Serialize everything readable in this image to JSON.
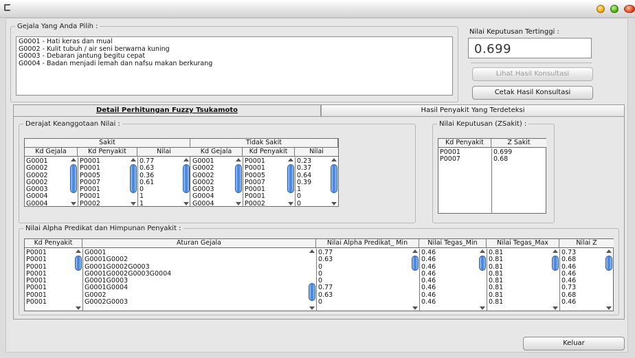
{
  "gejala_group": {
    "legend": "Gejala Yang Anda Pilih :",
    "items": [
      "G0001 - Hati keras dan mual",
      "G0002 - Kulit tubuh / air seni berwarna kuning",
      "G0003 - Debaran jantung begitu cepat",
      "G0004 - Badan menjadi lemah dan nafsu makan berkurang"
    ]
  },
  "keputusan": {
    "label": "Nilai Keputusan Tertinggi :",
    "value": "0.699"
  },
  "buttons": {
    "lihat": "Lihat Hasil Konsultasi",
    "cetak": "Cetak Hasil Konsultasi",
    "keluar": "Keluar"
  },
  "tabs": [
    {
      "label": "Detail Perhitungan Fuzzy Tsukamoto",
      "active": true
    },
    {
      "label": "Hasil Penyakit Yang Terdeteksi",
      "active": false
    }
  ],
  "derajat": {
    "legend": "Derajat Keanggotaan Nilai :",
    "sakit_title": "Sakit",
    "tidak_sakit_title": "Tidak Sakit",
    "headers": [
      "Kd Gejala",
      "Kd Penyakit",
      "Nilai"
    ],
    "sakit": {
      "kd_gejala": [
        "G0001",
        "G0002",
        "G0002",
        "G0002",
        "G0003",
        "G0004",
        "G0004"
      ],
      "kd_penyakit": [
        "P0001",
        "P0001",
        "P0005",
        "P0007",
        "P0001",
        "P0001",
        "P0002"
      ],
      "nilai": [
        "0.77",
        "0.63",
        "0.36",
        "0.61",
        "0",
        "1",
        "1"
      ]
    },
    "tidak_sakit": {
      "kd_gejala": [
        "G0001",
        "G0002",
        "G0002",
        "G0002",
        "G0003",
        "G0004",
        "G0004"
      ],
      "kd_penyakit": [
        "P0001",
        "P0001",
        "P0005",
        "P0007",
        "P0001",
        "P0001",
        "P0002"
      ],
      "nilai": [
        "0.23",
        "0.37",
        "0.64",
        "0.39",
        "1",
        "0",
        "0"
      ]
    }
  },
  "zsakit": {
    "legend": "Nilai Keputusan (ZSakit) :",
    "headers": [
      "Kd Penyakit",
      "Z Sakit"
    ],
    "kd_penyakit": [
      "P0001",
      "P0007"
    ],
    "z": [
      "0.699",
      "0.68"
    ]
  },
  "alpha": {
    "legend": "Nilai Alpha Predikat dan Himpunan Penyakit :",
    "headers": [
      "Kd Penyakit",
      "Aturan Gejala",
      "Nilai Alpha Predikat_ Min",
      "Nilai Tegas_Min",
      "Nilai Tegas_Max",
      "Nilai Z"
    ],
    "kd_penyakit": [
      "P0001",
      "P0001",
      "P0001",
      "P0001",
      "P0001",
      "P0001",
      "P0001",
      "P0001"
    ],
    "aturan": [
      "G0001",
      "G0001G0002",
      "G0001G0002G0003",
      "G0001G0002G0003G0004",
      "G0001G0003",
      "G0001G0004",
      "G0002",
      "G0002G0003"
    ],
    "alpha_min": [
      "0.77",
      "0.63",
      "0",
      "0",
      "0",
      "0.77",
      "0.63",
      "0"
    ],
    "tegas_min": [
      "0.46",
      "0.46",
      "0.46",
      "0.46",
      "0.46",
      "0.46",
      "0.46",
      "0.46"
    ],
    "tegas_max": [
      "0.81",
      "0.81",
      "0.81",
      "0.81",
      "0.81",
      "0.81",
      "0.81",
      "0.81"
    ],
    "nilai_z": [
      "0.73",
      "0.68",
      "0.46",
      "0.46",
      "0.46",
      "0.73",
      "0.68",
      "0.46"
    ]
  }
}
